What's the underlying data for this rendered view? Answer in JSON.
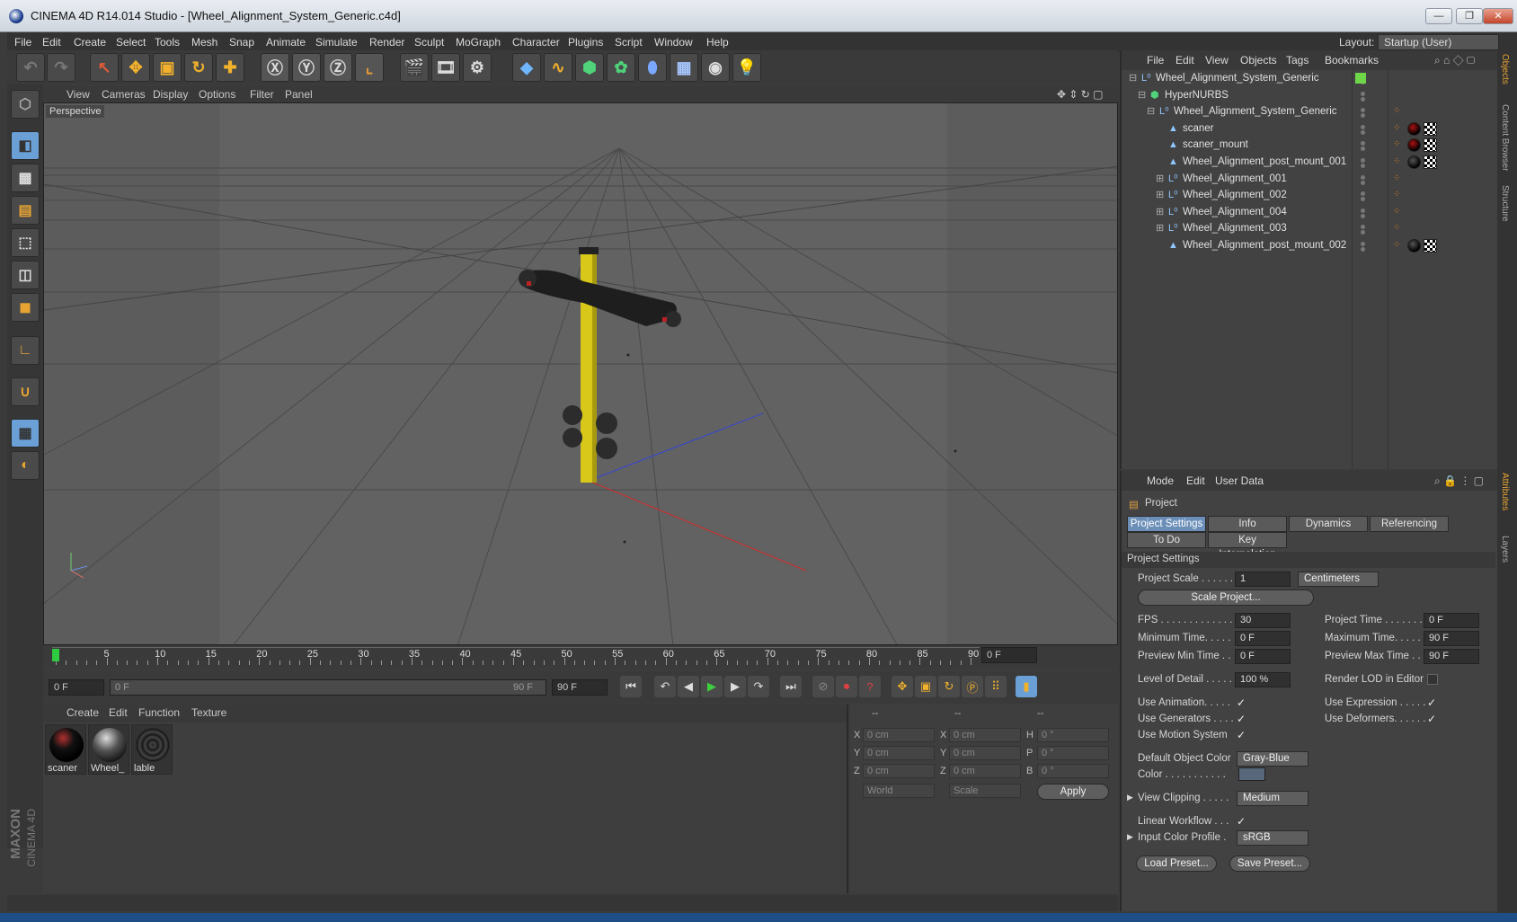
{
  "window": {
    "title": "CINEMA 4D R14.014 Studio - [Wheel_Alignment_System_Generic.c4d]",
    "min": "—",
    "max": "❐",
    "close": "✕"
  },
  "menu": [
    "File",
    "Edit",
    "Create",
    "Select",
    "Tools",
    "Mesh",
    "Snap",
    "Animate",
    "Simulate",
    "Render",
    "Sculpt",
    "MoGraph",
    "Character",
    "Plugins",
    "Script",
    "Window",
    "Help"
  ],
  "layout": {
    "label": "Layout:",
    "value": "Startup (User)"
  },
  "viewport": {
    "menu": [
      "View",
      "Cameras",
      "Display",
      "Options",
      "Filter",
      "Panel"
    ],
    "label": "Perspective"
  },
  "timeline": {
    "ticks": [
      "0",
      "5",
      "10",
      "15",
      "20",
      "25",
      "30",
      "35",
      "40",
      "45",
      "50",
      "55",
      "60",
      "65",
      "70",
      "75",
      "80",
      "85",
      "90"
    ],
    "current": "0 F"
  },
  "transport": {
    "start": "0 F",
    "range_start": "0 F",
    "range_end": "90 F",
    "end": "90 F"
  },
  "materials": {
    "menu": [
      "Create",
      "Edit",
      "Function",
      "Texture"
    ],
    "items": [
      {
        "label": "scaner"
      },
      {
        "label": "Wheel_"
      },
      {
        "label": "lable"
      }
    ]
  },
  "coords": {
    "headers": [
      "--",
      "--",
      "--"
    ],
    "rows": [
      {
        "a": "X",
        "av": "0 cm",
        "b": "X",
        "bv": "0 cm",
        "c": "H",
        "cv": "0 °"
      },
      {
        "a": "Y",
        "av": "0 cm",
        "b": "Y",
        "bv": "0 cm",
        "c": "P",
        "cv": "0 °"
      },
      {
        "a": "Z",
        "av": "0 cm",
        "b": "Z",
        "bv": "0 cm",
        "c": "B",
        "cv": "0 °"
      }
    ],
    "mode1": "World",
    "mode2": "Scale",
    "apply": "Apply"
  },
  "objects": {
    "menu": [
      "File",
      "Edit",
      "View",
      "Objects",
      "Tags",
      "Bookmarks"
    ],
    "rows": [
      {
        "name": "Wheel_Alignment_System_Generic",
        "indent": 0,
        "icon": "null"
      },
      {
        "name": "HyperNURBS",
        "indent": 1,
        "icon": "nurbs"
      },
      {
        "name": "Wheel_Alignment_System_Generic",
        "indent": 2,
        "icon": "null"
      },
      {
        "name": "scaner",
        "indent": 3,
        "icon": "poly"
      },
      {
        "name": "scaner_mount",
        "indent": 3,
        "icon": "poly"
      },
      {
        "name": "Wheel_Alignment_post_mount_001",
        "indent": 3,
        "icon": "poly"
      },
      {
        "name": "Wheel_Alignment_001",
        "indent": 3,
        "icon": "null"
      },
      {
        "name": "Wheel_Alignment_002",
        "indent": 3,
        "icon": "null"
      },
      {
        "name": "Wheel_Alignment_004",
        "indent": 3,
        "icon": "null"
      },
      {
        "name": "Wheel_Alignment_003",
        "indent": 3,
        "icon": "null"
      },
      {
        "name": "Wheel_Alignment_post_mount_002",
        "indent": 3,
        "icon": "poly"
      }
    ]
  },
  "attributes": {
    "menu": [
      "Mode",
      "Edit",
      "User Data"
    ],
    "object": "Project",
    "tabs": [
      "Project Settings",
      "Info",
      "Dynamics",
      "Referencing",
      "To Do",
      "Key Interpolation"
    ],
    "section": "Project Settings",
    "project_scale": {
      "label": "Project Scale . . . . . .",
      "value": "1",
      "unit": "Centimeters"
    },
    "scale_project": "Scale Project...",
    "fps": {
      "label": "FPS . . . . . . . . . . . . . .",
      "value": "30"
    },
    "project_time": {
      "label": "Project Time . . . . . . .",
      "value": "0 F"
    },
    "min_time": {
      "label": "Minimum Time. . . . .",
      "value": "0 F"
    },
    "max_time": {
      "label": "Maximum Time. . . . .",
      "value": "90 F"
    },
    "prev_min": {
      "label": "Preview Min Time . .",
      "value": "0 F"
    },
    "prev_max": {
      "label": "Preview Max Time . .",
      "value": "90 F"
    },
    "lod": {
      "label": "Level of Detail . . . . .",
      "value": "100 %"
    },
    "render_lod": "Render LOD in Editor",
    "use_anim": "Use Animation. . . . .",
    "use_expr": "Use Expression . . . . .",
    "use_gen": "Use Generators . . . .",
    "use_def": "Use Deformers. . . . . .",
    "use_motion": "Use Motion System",
    "def_color": {
      "label": "Default Object Color",
      "value": "Gray-Blue"
    },
    "color": "Color . . . . . . . . . . .",
    "clipping": {
      "label": "View Clipping . . . . .",
      "value": "Medium"
    },
    "linear": "Linear Workflow . . .",
    "icp": {
      "label": "Input Color Profile .",
      "value": "sRGB"
    },
    "load": "Load Preset...",
    "save": "Save Preset..."
  },
  "right_tabs": [
    "Objects",
    "Content Browser",
    "Structure",
    "Attributes",
    "Layers"
  ],
  "logo": {
    "line1": "MAXON",
    "line2": "CINEMA 4D"
  }
}
